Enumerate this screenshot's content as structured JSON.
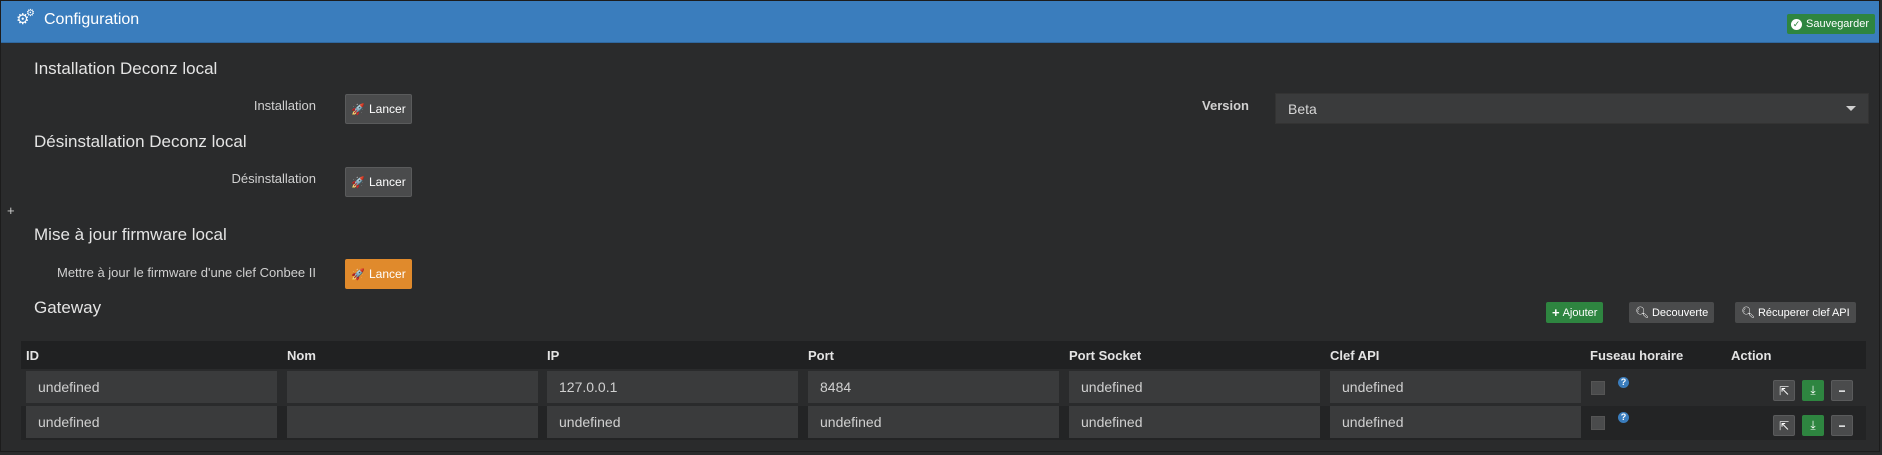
{
  "header": {
    "title": "Configuration",
    "icon": "gears-icon",
    "save_label": "Sauvegarder"
  },
  "install": {
    "section_title": "Installation Deconz local",
    "label": "Installation",
    "button": "Lancer",
    "version_label": "Version",
    "version_value": "Beta"
  },
  "uninstall": {
    "section_title": "Désinstallation Deconz local",
    "label": "Désinstallation",
    "button": "Lancer"
  },
  "firmware": {
    "section_title": "Mise à jour firmware local",
    "label": "Mettre à jour le firmware d'une clef Conbee II",
    "button": "Lancer"
  },
  "misc": {
    "plus": "+"
  },
  "gateway": {
    "section_title": "Gateway",
    "add_label": "Ajouter",
    "discover_label": "Decouverte",
    "apikey_label": "Récuperer clef API",
    "columns": [
      "ID",
      "Nom",
      "IP",
      "Port",
      "Port Socket",
      "Clef API",
      "Fuseau horaire",
      "Action"
    ],
    "rows": [
      {
        "id": "undefined",
        "nom": "",
        "ip": "127.0.0.1",
        "port": "8484",
        "port_socket": "undefined",
        "clef_api": "undefined"
      },
      {
        "id": "undefined",
        "nom": "",
        "ip": "undefined",
        "port": "undefined",
        "port_socket": "undefined",
        "clef_api": "undefined"
      }
    ]
  },
  "colors": {
    "header": "#3a7dbd",
    "success": "#2e8540",
    "warning": "#e08a2c",
    "background": "#2a2b2c"
  }
}
